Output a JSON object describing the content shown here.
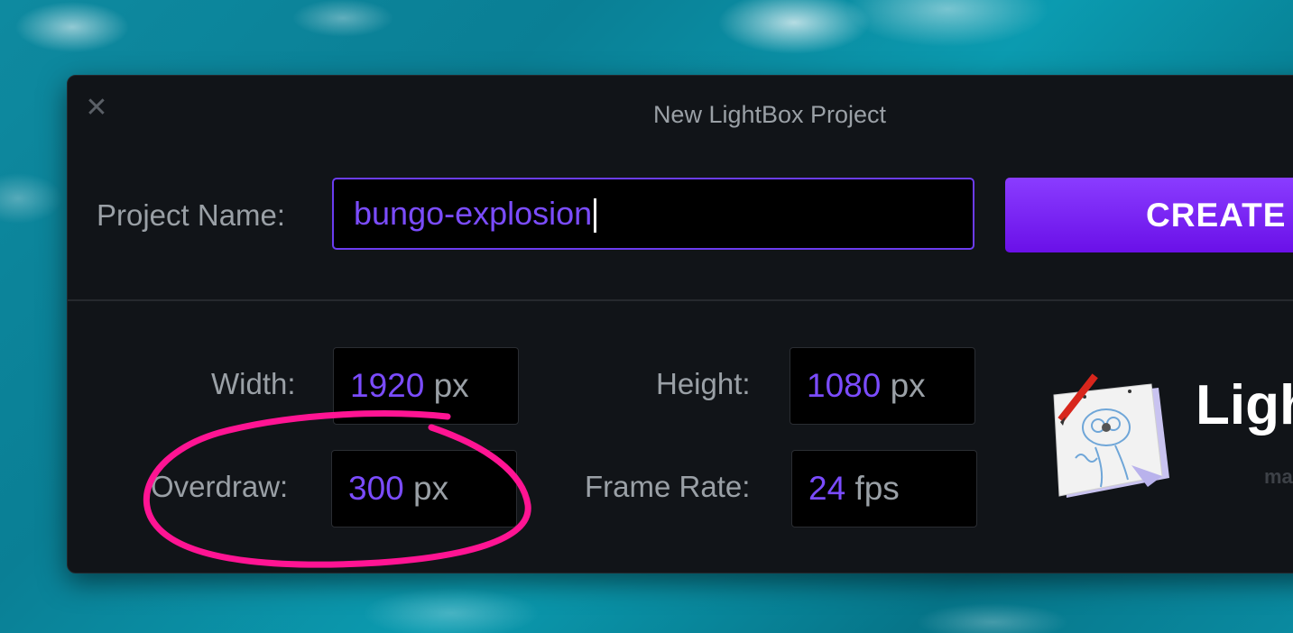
{
  "window": {
    "title": "New LightBox Project",
    "close_icon": "close-icon"
  },
  "project": {
    "label": "Project Name:",
    "value": "bungo-explosion"
  },
  "create_button": {
    "label": "CREATE"
  },
  "fields": {
    "width": {
      "label": "Width:",
      "value": "1920",
      "unit": "px"
    },
    "height": {
      "label": "Height:",
      "value": "1080",
      "unit": "px"
    },
    "overdraw": {
      "label": "Overdraw:",
      "value": "300",
      "unit": "px"
    },
    "frame_rate": {
      "label": "Frame Rate:",
      "value": "24",
      "unit": "fps"
    }
  },
  "app": {
    "name": "Ligh",
    "subtitle": "ma",
    "icon": "lightbox-sketch-app-icon"
  },
  "colors": {
    "accent": "#7b4cff",
    "button_gradient_top": "#8a3cff",
    "button_gradient_bottom": "#6a10e8",
    "annotation": "#ff1493",
    "window_bg": "#111418"
  }
}
